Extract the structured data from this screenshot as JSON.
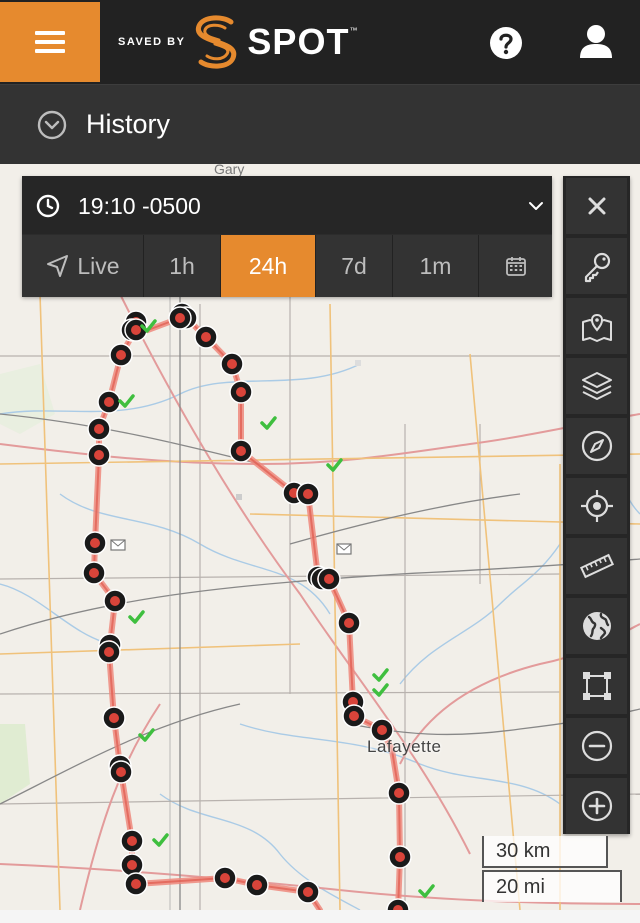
{
  "header": {
    "menu_icon": "hamburger-menu-icon",
    "logo_prefix": "SAVED BY",
    "logo_word": "SPOT",
    "logo_tm": "™",
    "help_icon": "help-circle-icon",
    "user_icon": "user-account-icon"
  },
  "subheader": {
    "toggle_icon": "chevron-down-circle-icon",
    "title": "History"
  },
  "time_panel": {
    "clock_icon": "clock-icon",
    "time_text": "19:10 -0500",
    "dropdown_icon": "chevron-down-icon",
    "tabs": [
      {
        "label": "Live",
        "icon": "location-arrow-icon",
        "active": false
      },
      {
        "label": "1h",
        "active": false
      },
      {
        "label": "24h",
        "active": true
      },
      {
        "label": "7d",
        "active": false
      },
      {
        "label": "1m",
        "active": false
      },
      {
        "label": "",
        "icon": "calendar-icon",
        "active": false
      }
    ]
  },
  "tools": [
    {
      "name": "close",
      "icon": "close-icon"
    },
    {
      "name": "key",
      "icon": "key-icon"
    },
    {
      "name": "map-layers",
      "icon": "folded-map-pin-icon"
    },
    {
      "name": "layers",
      "icon": "stacked-layers-icon"
    },
    {
      "name": "compass",
      "icon": "compass-icon"
    },
    {
      "name": "locate",
      "icon": "crosshair-target-icon"
    },
    {
      "name": "measure",
      "icon": "ruler-icon"
    },
    {
      "name": "globe",
      "icon": "globe-icon"
    },
    {
      "name": "fit-bounds",
      "icon": "bounding-box-icon"
    },
    {
      "name": "zoom-out",
      "icon": "zoom-out-minus-icon"
    },
    {
      "name": "zoom-in",
      "icon": "zoom-in-plus-icon"
    }
  ],
  "map": {
    "city_label": "Lafayette",
    "faded_label": "Gary",
    "track_color": "#ef8a7e",
    "marker_color": "#d9443a",
    "check_color": "#3fbf3f",
    "scale_km": "30 km",
    "scale_mi": "20 mi"
  },
  "colors": {
    "accent": "#e68a2e",
    "header_bg": "#222222",
    "panel_bg": "#333333"
  }
}
